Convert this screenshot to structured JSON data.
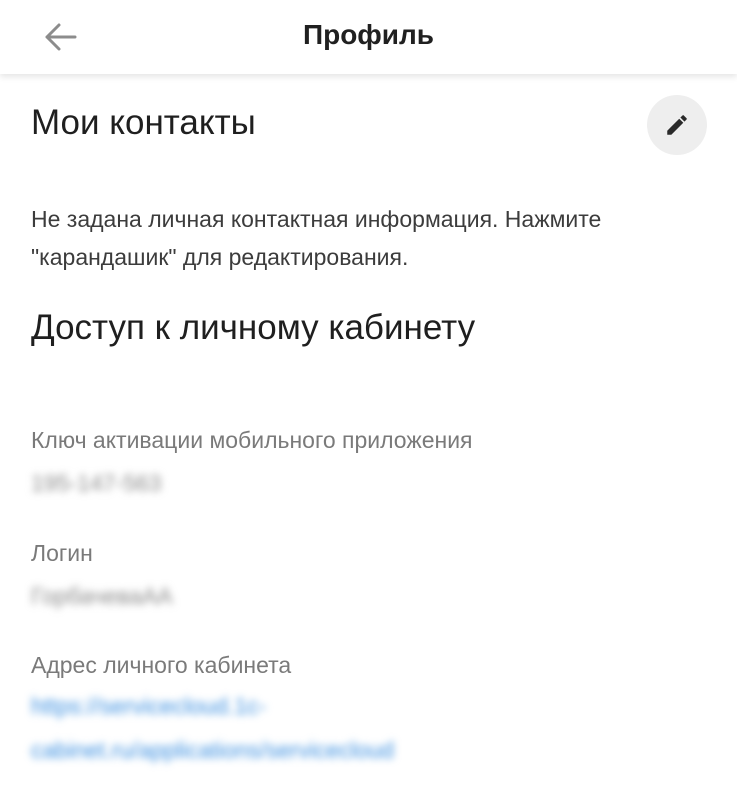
{
  "header": {
    "title": "Профиль",
    "back_icon": "arrow-left-icon"
  },
  "contacts": {
    "title": "Мои контакты",
    "edit_icon": "pencil-icon",
    "empty_text": "Не задана личная контактная информация. Нажмите \"карандашик\" для редактирования."
  },
  "access": {
    "title": "Доступ к личному кабинету",
    "activation_key": {
      "label": "Ключ активации мобильного приложения",
      "value": "195-147-563"
    },
    "login": {
      "label": "Логин",
      "value": "ГорбачеваАА"
    },
    "cabinet_address": {
      "label": "Адрес личного кабинета",
      "value": "https://servicecloud.1c-cabinet.ru/applications/servicecloud"
    }
  },
  "colors": {
    "link": "#3b8fe0",
    "edit_button_bg": "#eeeeee",
    "label": "#7a7a7a"
  }
}
